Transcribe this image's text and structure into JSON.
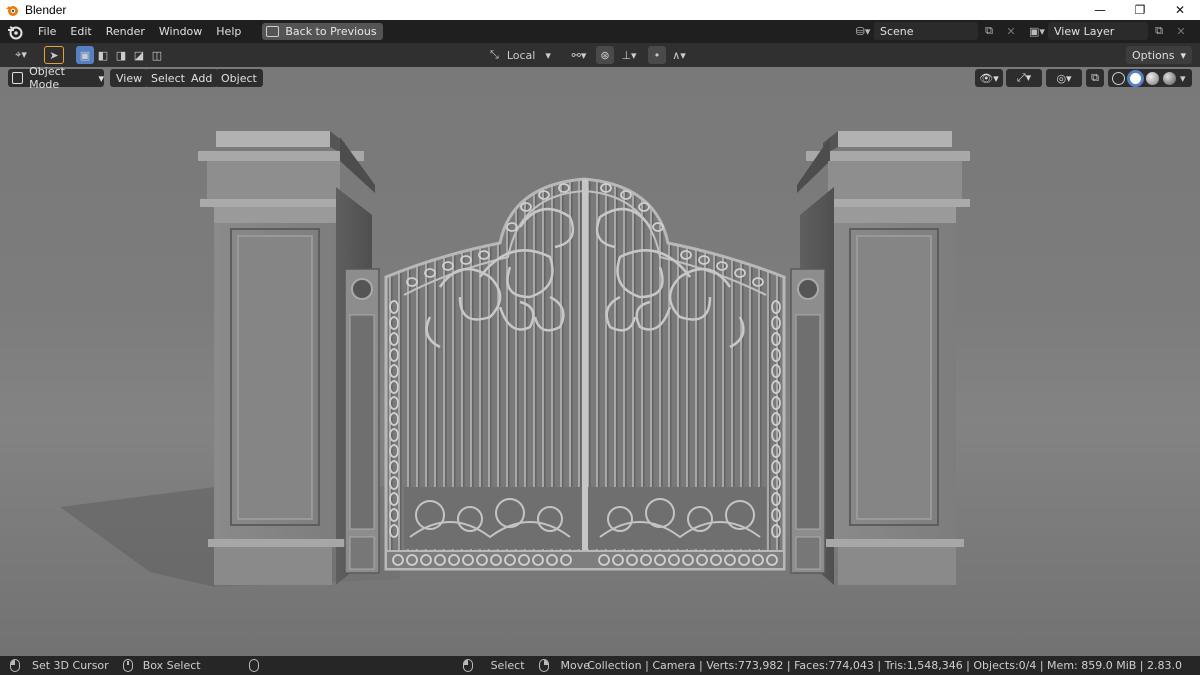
{
  "window": {
    "title": "Blender",
    "controls": [
      "—",
      "❐",
      "✕"
    ]
  },
  "topbar": {
    "menus": [
      "File",
      "Edit",
      "Render",
      "Window",
      "Help"
    ],
    "back_button": "Back to Previous",
    "scene_name": "Scene",
    "view_layer": "View Layer"
  },
  "toolheader": {
    "transform_orientation": "Local",
    "options_label": "Options"
  },
  "viewport_header": {
    "mode": "Object Mode",
    "menus": [
      "View",
      "Select",
      "Add",
      "Object"
    ]
  },
  "statusbar": {
    "left_hint": "Set 3D Cursor",
    "middle_hint": "Box Select",
    "select_hint": "Select",
    "move_hint": "Move",
    "stats": "Collection | Camera | Verts:773,982 | Faces:774,043 | Tris:1,548,346 | Objects:0/4 | Mem: 859.0 MiB | 2.83.0"
  },
  "colors": {
    "accent": "#5680c2",
    "blender_orange": "#e87d0d",
    "viewport_bg": "#7c7c7c"
  }
}
